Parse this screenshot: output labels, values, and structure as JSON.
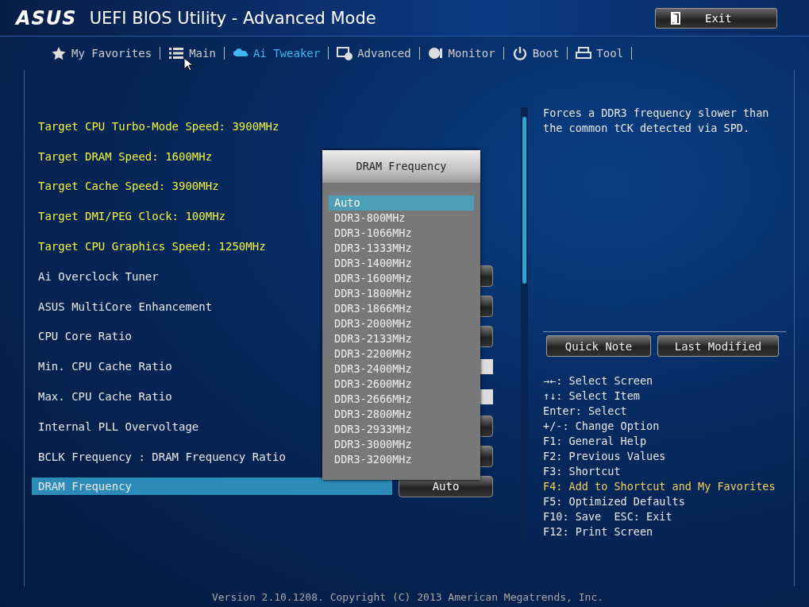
{
  "header": {
    "logo": "ASUS",
    "title": "UEFI BIOS Utility - Advanced Mode",
    "exit_button": "Exit"
  },
  "tabs": [
    {
      "label": "My Favorites",
      "selected": false
    },
    {
      "label": "Main",
      "selected": false
    },
    {
      "label": "Ai Tweaker",
      "selected": true
    },
    {
      "label": "Advanced",
      "selected": false
    },
    {
      "label": "Monitor",
      "selected": false
    },
    {
      "label": "Boot",
      "selected": false
    },
    {
      "label": "Tool",
      "selected": false
    }
  ],
  "settings": [
    {
      "kind": "info",
      "label": "Target CPU Turbo-Mode Speed: 3900MHz",
      "selected": false
    },
    {
      "kind": "info",
      "label": "Target DRAM Speed: 1600MHz",
      "selected": false
    },
    {
      "kind": "info",
      "label": "Target Cache Speed: 3900MHz",
      "selected": false
    },
    {
      "kind": "info",
      "label": "Target DMI/PEG Clock: 100MHz",
      "selected": false
    },
    {
      "kind": "info",
      "label": "Target CPU Graphics Speed: 1250MHz",
      "selected": false
    },
    {
      "kind": "dropdown",
      "label": "Ai Overclock Tuner",
      "selected": false
    },
    {
      "kind": "dropdown",
      "label": "ASUS MultiCore Enhancement",
      "selected": false
    },
    {
      "kind": "dropdown",
      "label": "CPU Core Ratio",
      "selected": false
    },
    {
      "kind": "field",
      "label": "Min. CPU Cache Ratio",
      "selected": false
    },
    {
      "kind": "field",
      "label": "Max. CPU Cache Ratio",
      "selected": false
    },
    {
      "kind": "dropdown",
      "label": "Internal PLL Overvoltage",
      "selected": false
    },
    {
      "kind": "dropdown",
      "label": "BCLK Frequency : DRAM Frequency Ratio",
      "selected": false
    },
    {
      "kind": "dropdown",
      "label": "DRAM Frequency",
      "selected": true,
      "value": "Auto"
    }
  ],
  "popup": {
    "title": "DRAM Frequency",
    "options": [
      {
        "label": "Auto",
        "selected": true
      },
      {
        "label": "DDR3-800MHz",
        "selected": false
      },
      {
        "label": "DDR3-1066MHz",
        "selected": false
      },
      {
        "label": "DDR3-1333MHz",
        "selected": false
      },
      {
        "label": "DDR3-1400MHz",
        "selected": false
      },
      {
        "label": "DDR3-1600MHz",
        "selected": false
      },
      {
        "label": "DDR3-1800MHz",
        "selected": false
      },
      {
        "label": "DDR3-1866MHz",
        "selected": false
      },
      {
        "label": "DDR3-2000MHz",
        "selected": false
      },
      {
        "label": "DDR3-2133MHz",
        "selected": false
      },
      {
        "label": "DDR3-2200MHz",
        "selected": false
      },
      {
        "label": "DDR3-2400MHz",
        "selected": false
      },
      {
        "label": "DDR3-2600MHz",
        "selected": false
      },
      {
        "label": "DDR3-2666MHz",
        "selected": false
      },
      {
        "label": "DDR3-2800MHz",
        "selected": false
      },
      {
        "label": "DDR3-2933MHz",
        "selected": false
      },
      {
        "label": "DDR3-3000MHz",
        "selected": false
      },
      {
        "label": "DDR3-3200MHz",
        "selected": false
      }
    ]
  },
  "help": {
    "description": "Forces a DDR3 frequency slower than the common tCK detected via SPD.",
    "buttons": [
      "Quick Note",
      "Last Modified"
    ],
    "keys": [
      {
        "text": "→←: Select Screen",
        "highlighted": false
      },
      {
        "text": "↑↓: Select Item",
        "highlighted": false
      },
      {
        "text": "Enter: Select",
        "highlighted": false
      },
      {
        "text": "+/-: Change Option",
        "highlighted": false
      },
      {
        "text": "F1: General Help",
        "highlighted": false
      },
      {
        "text": "F2: Previous Values",
        "highlighted": false
      },
      {
        "text": "F3: Shortcut",
        "highlighted": false
      },
      {
        "text": "F4: Add to Shortcut and My Favorites",
        "highlighted": true
      },
      {
        "text": "F5: Optimized Defaults",
        "highlighted": false
      },
      {
        "text": "F10: Save  ESC: Exit",
        "highlighted": false
      },
      {
        "text": "F12: Print Screen",
        "highlighted": false
      }
    ]
  },
  "footer": "Version 2.10.1208. Copyright (C) 2013 American Megatrends, Inc."
}
